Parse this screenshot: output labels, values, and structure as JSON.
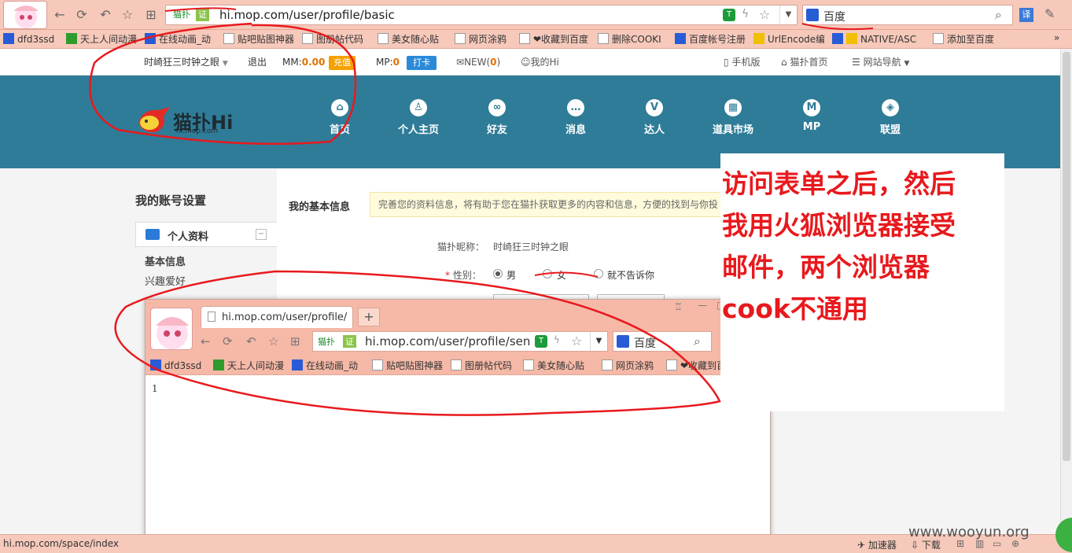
{
  "browser": {
    "url": "hi.mop.com/user/profile/basic",
    "url_tag": "猫扑",
    "cert_tag": "证",
    "search_engine": "百度",
    "translate_label": "译",
    "bookmarks": [
      "dfd3ssd",
      "天上人间动漫",
      "在线动画_动",
      "贴吧贴图神器",
      "图册帖代码",
      "美女随心贴",
      "网页涂鸦",
      "❤收藏到百度",
      "删除COOKI",
      "百度帐号注册",
      "UrlEncode编",
      "NATIVE/ASC",
      "添加至百度"
    ]
  },
  "site": {
    "username": "时崎狂三时钟之眼",
    "logout": "退出",
    "mm_label": "MM:",
    "mm_value": "0.00",
    "recharge": "充值",
    "mp_label": "MP:",
    "mp_value": "0",
    "checkin": "打卡",
    "new_label": "NEW(",
    "new_count": "0",
    "new_close": ")",
    "myhi": "我的Hi",
    "mobile": "手机版",
    "home": "猫扑首页",
    "sitenav": "网站导航",
    "logo_text": "猫扑Hi",
    "logo_sub": "hi.mop.com",
    "nav": [
      {
        "label": "首页",
        "icon": "home-icon",
        "glyph": "⌂"
      },
      {
        "label": "个人主页",
        "icon": "user-icon",
        "glyph": "♙"
      },
      {
        "label": "好友",
        "icon": "friends-icon",
        "glyph": "∞"
      },
      {
        "label": "消息",
        "icon": "message-icon",
        "glyph": "…"
      },
      {
        "label": "达人",
        "icon": "expert-icon",
        "glyph": "V"
      },
      {
        "label": "道具市场",
        "icon": "market-icon",
        "glyph": "▦"
      },
      {
        "label": "MP",
        "icon": "mp-icon",
        "glyph": "M"
      },
      {
        "label": "联盟",
        "icon": "alliance-icon",
        "glyph": "◈"
      }
    ]
  },
  "settings": {
    "title": "我的账号设置",
    "section": "个人资料",
    "items": [
      "基本信息",
      "兴趣爱好"
    ],
    "main_title": "我的基本信息",
    "notice": "完善您的资料信息，将有助于您在猫扑获取更多的内容和信息，方便的找到与你投",
    "nickname_label": "猫扑昵称：",
    "nickname_value": "时崎狂三时钟之眼",
    "gender_label": "性别：",
    "gender_options": [
      "男",
      "女",
      "就不告诉你"
    ]
  },
  "popup": {
    "tab_title": "hi.mop.com/user/profile/",
    "url": "hi.mop.com/user/profile/sen",
    "url_tag": "猫扑",
    "cert_tag": "证",
    "search_engine": "百度",
    "bookmarks": [
      "dfd3ssd",
      "天上人间动漫",
      "在线动画_动",
      "贴吧贴图神器",
      "图册帖代码",
      "美女随心贴",
      "网页涂鸦",
      "❤收藏到百度"
    ],
    "body_text": "1"
  },
  "annotation": {
    "lines": [
      "访问表单之后，然后",
      "我用火狐浏览器接受",
      "邮件，两个浏览器",
      "cook不通用"
    ]
  },
  "status": {
    "url": "hi.mop.com/space/index",
    "accel": "加速器",
    "download": "下载",
    "watermark": "www.wooyun.org"
  },
  "colors": {
    "header": "#2f7c98",
    "chrome": "#f6c9bb",
    "annotation": "#e8191d"
  }
}
